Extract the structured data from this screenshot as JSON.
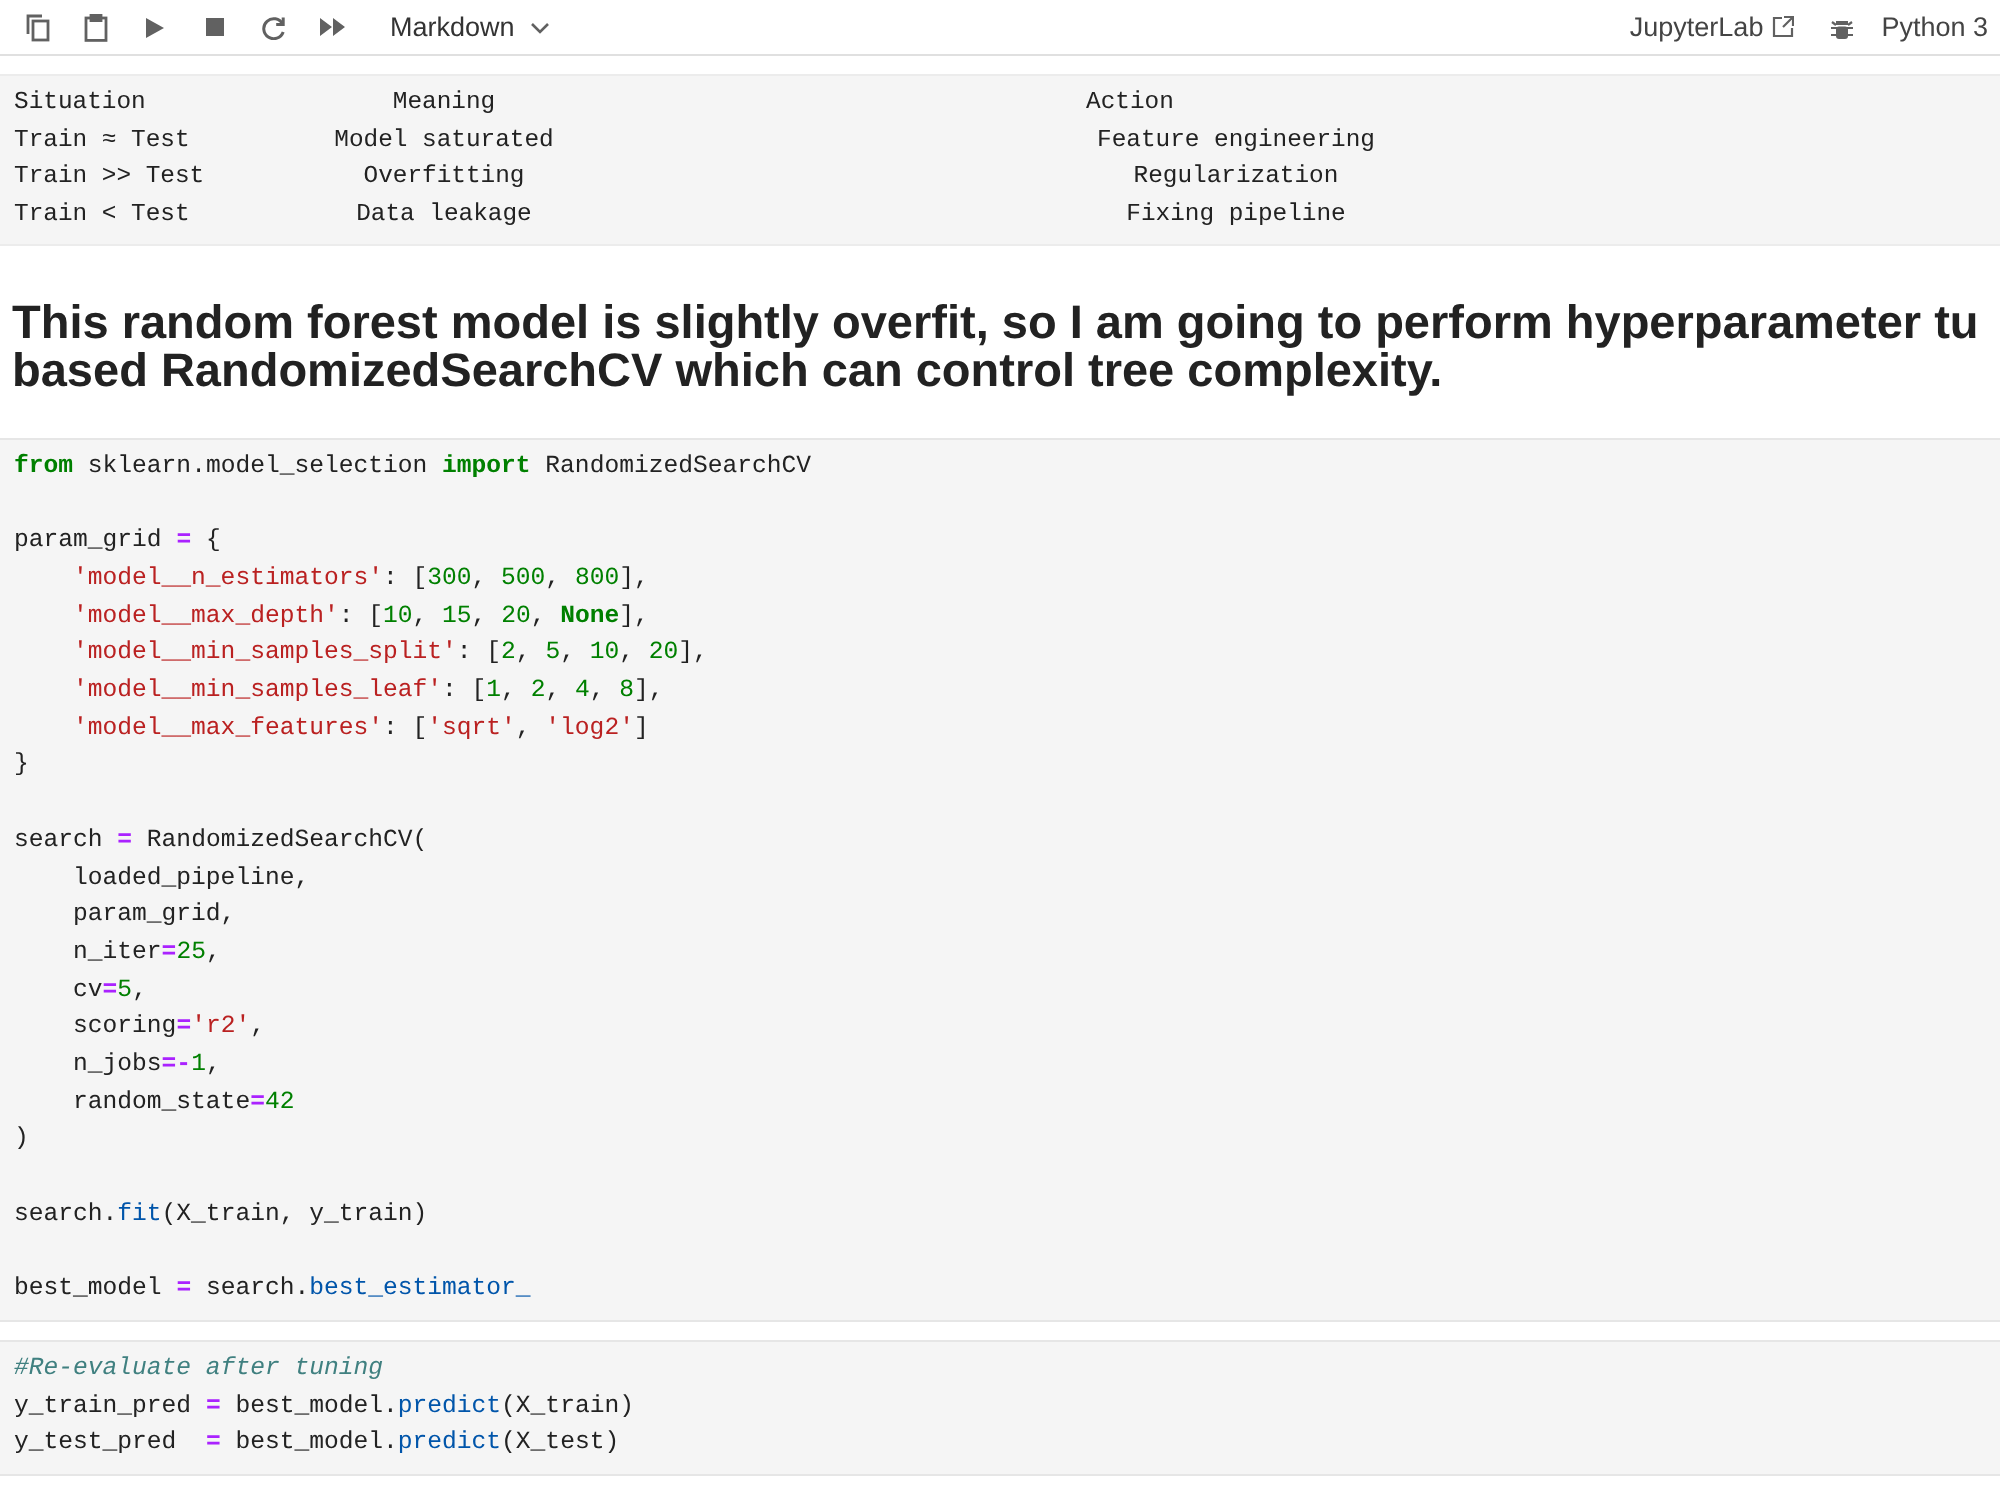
{
  "toolbar": {
    "buttons": [
      {
        "kind": "copy"
      },
      {
        "kind": "paste"
      },
      {
        "kind": "run"
      },
      {
        "kind": "stop"
      },
      {
        "kind": "restart"
      },
      {
        "kind": "run-all"
      }
    ],
    "cell_type": "Markdown",
    "link": "JupyterLab",
    "kernel": "Python 3"
  },
  "output_table": {
    "columns": [
      "Situation",
      "Meaning",
      "Action"
    ],
    "rows": [
      [
        "Train ≈ Test",
        "Model saturated",
        "Feature engineering"
      ],
      [
        "Train >> Test",
        "Overfitting",
        "Regularization"
      ],
      [
        "Train < Test",
        "Data leakage",
        "Fixing pipeline"
      ]
    ]
  },
  "heading": {
    "lines": [
      "This random forest model is slightly overfit, so I am going to perform hyperparameter tu",
      "based RandomizedSearchCV which can control tree complexity."
    ]
  },
  "code_cells": [
    {
      "lines": [
        {
          "tokens": [
            {
              "kind": "keyword",
              "text": "from"
            },
            {
              "kind": "plain",
              "text": " sklearn.model_selection "
            },
            {
              "kind": "keyword",
              "text": "import"
            },
            {
              "kind": "plain",
              "text": " RandomizedSearchCV"
            }
          ]
        },
        {
          "blank_before": true,
          "tokens": [
            {
              "kind": "plain",
              "text": "param_grid "
            },
            {
              "kind": "operator",
              "text": "="
            },
            {
              "kind": "plain",
              "text": " {"
            }
          ]
        },
        {
          "tokens": [
            {
              "kind": "string",
              "text": "    'model__n_estimators'"
            },
            {
              "kind": "plain",
              "text": ": ["
            },
            {
              "kind": "number",
              "text": "300"
            },
            {
              "kind": "plain",
              "text": ", "
            },
            {
              "kind": "number",
              "text": "500"
            },
            {
              "kind": "plain",
              "text": ", "
            },
            {
              "kind": "number",
              "text": "800"
            },
            {
              "kind": "plain",
              "text": "],"
            }
          ]
        },
        {
          "tokens": [
            {
              "kind": "string",
              "text": "    'model__max_depth'"
            },
            {
              "kind": "plain",
              "text": ": ["
            },
            {
              "kind": "number",
              "text": "10"
            },
            {
              "kind": "plain",
              "text": ", "
            },
            {
              "kind": "number",
              "text": "15"
            },
            {
              "kind": "plain",
              "text": ", "
            },
            {
              "kind": "number",
              "text": "20"
            },
            {
              "kind": "plain",
              "text": ", "
            },
            {
              "kind": "keyword",
              "text": "None"
            },
            {
              "kind": "plain",
              "text": "],"
            }
          ]
        },
        {
          "tokens": [
            {
              "kind": "string",
              "text": "    'model__min_samples_split'"
            },
            {
              "kind": "plain",
              "text": ": ["
            },
            {
              "kind": "number",
              "text": "2"
            },
            {
              "kind": "plain",
              "text": ", "
            },
            {
              "kind": "number",
              "text": "5"
            },
            {
              "kind": "plain",
              "text": ", "
            },
            {
              "kind": "number",
              "text": "10"
            },
            {
              "kind": "plain",
              "text": ", "
            },
            {
              "kind": "number",
              "text": "20"
            },
            {
              "kind": "plain",
              "text": "],"
            }
          ]
        },
        {
          "tokens": [
            {
              "kind": "string",
              "text": "    'model__min_samples_leaf'"
            },
            {
              "kind": "plain",
              "text": ": ["
            },
            {
              "kind": "number",
              "text": "1"
            },
            {
              "kind": "plain",
              "text": ", "
            },
            {
              "kind": "number",
              "text": "2"
            },
            {
              "kind": "plain",
              "text": ", "
            },
            {
              "kind": "number",
              "text": "4"
            },
            {
              "kind": "plain",
              "text": ", "
            },
            {
              "kind": "number",
              "text": "8"
            },
            {
              "kind": "plain",
              "text": "],"
            }
          ]
        },
        {
          "tokens": [
            {
              "kind": "string",
              "text": "    'model__max_features'"
            },
            {
              "kind": "plain",
              "text": ": ["
            },
            {
              "kind": "string",
              "text": "'sqrt'"
            },
            {
              "kind": "plain",
              "text": ", "
            },
            {
              "kind": "string",
              "text": "'log2'"
            },
            {
              "kind": "plain",
              "text": "]"
            }
          ]
        },
        {
          "tokens": [
            {
              "kind": "plain",
              "text": "}"
            }
          ]
        },
        {
          "blank_before": true,
          "tokens": [
            {
              "kind": "plain",
              "text": "search "
            },
            {
              "kind": "operator",
              "text": "="
            },
            {
              "kind": "plain",
              "text": " RandomizedSearchCV("
            }
          ]
        },
        {
          "tokens": [
            {
              "kind": "plain",
              "text": "    loaded_pipeline,"
            }
          ]
        },
        {
          "tokens": [
            {
              "kind": "plain",
              "text": "    param_grid,"
            }
          ]
        },
        {
          "tokens": [
            {
              "kind": "plain",
              "text": "    n_iter"
            },
            {
              "kind": "operator",
              "text": "="
            },
            {
              "kind": "number",
              "text": "25"
            },
            {
              "kind": "plain",
              "text": ","
            }
          ]
        },
        {
          "tokens": [
            {
              "kind": "plain",
              "text": "    cv"
            },
            {
              "kind": "operator",
              "text": "="
            },
            {
              "kind": "number",
              "text": "5"
            },
            {
              "kind": "plain",
              "text": ","
            }
          ]
        },
        {
          "tokens": [
            {
              "kind": "plain",
              "text": "    scoring"
            },
            {
              "kind": "operator",
              "text": "="
            },
            {
              "kind": "string",
              "text": "'r2'"
            },
            {
              "kind": "plain",
              "text": ","
            }
          ]
        },
        {
          "tokens": [
            {
              "kind": "plain",
              "text": "    n_jobs"
            },
            {
              "kind": "operator",
              "text": "=-"
            },
            {
              "kind": "number",
              "text": "1"
            },
            {
              "kind": "plain",
              "text": ","
            }
          ]
        },
        {
          "tokens": [
            {
              "kind": "plain",
              "text": "    random_state"
            },
            {
              "kind": "operator",
              "text": "="
            },
            {
              "kind": "number",
              "text": "42"
            }
          ]
        },
        {
          "tokens": [
            {
              "kind": "plain",
              "text": ")"
            }
          ]
        },
        {
          "blank_before": true,
          "tokens": [
            {
              "kind": "plain",
              "text": "search."
            },
            {
              "kind": "function",
              "text": "fit"
            },
            {
              "kind": "plain",
              "text": "(X_train, y_train)"
            }
          ]
        },
        {
          "blank_before": true,
          "tokens": [
            {
              "kind": "plain",
              "text": "best_model "
            },
            {
              "kind": "operator",
              "text": "="
            },
            {
              "kind": "plain",
              "text": " search."
            },
            {
              "kind": "function",
              "text": "best_estimator_"
            }
          ]
        }
      ]
    },
    {
      "lines": [
        {
          "tokens": [
            {
              "kind": "comment",
              "text": "#Re-evaluate after tuning"
            }
          ]
        },
        {
          "tokens": [
            {
              "kind": "plain",
              "text": "y_train_pred "
            },
            {
              "kind": "operator",
              "text": "="
            },
            {
              "kind": "plain",
              "text": " best_model."
            },
            {
              "kind": "function",
              "text": "predict"
            },
            {
              "kind": "plain",
              "text": "(X_train)"
            }
          ]
        },
        {
          "tokens": [
            {
              "kind": "plain",
              "text": "y_test_pred  "
            },
            {
              "kind": "operator",
              "text": "="
            },
            {
              "kind": "plain",
              "text": " best_model."
            },
            {
              "kind": "function",
              "text": "predict"
            },
            {
              "kind": "plain",
              "text": "(X_test)"
            }
          ]
        }
      ]
    }
  ]
}
